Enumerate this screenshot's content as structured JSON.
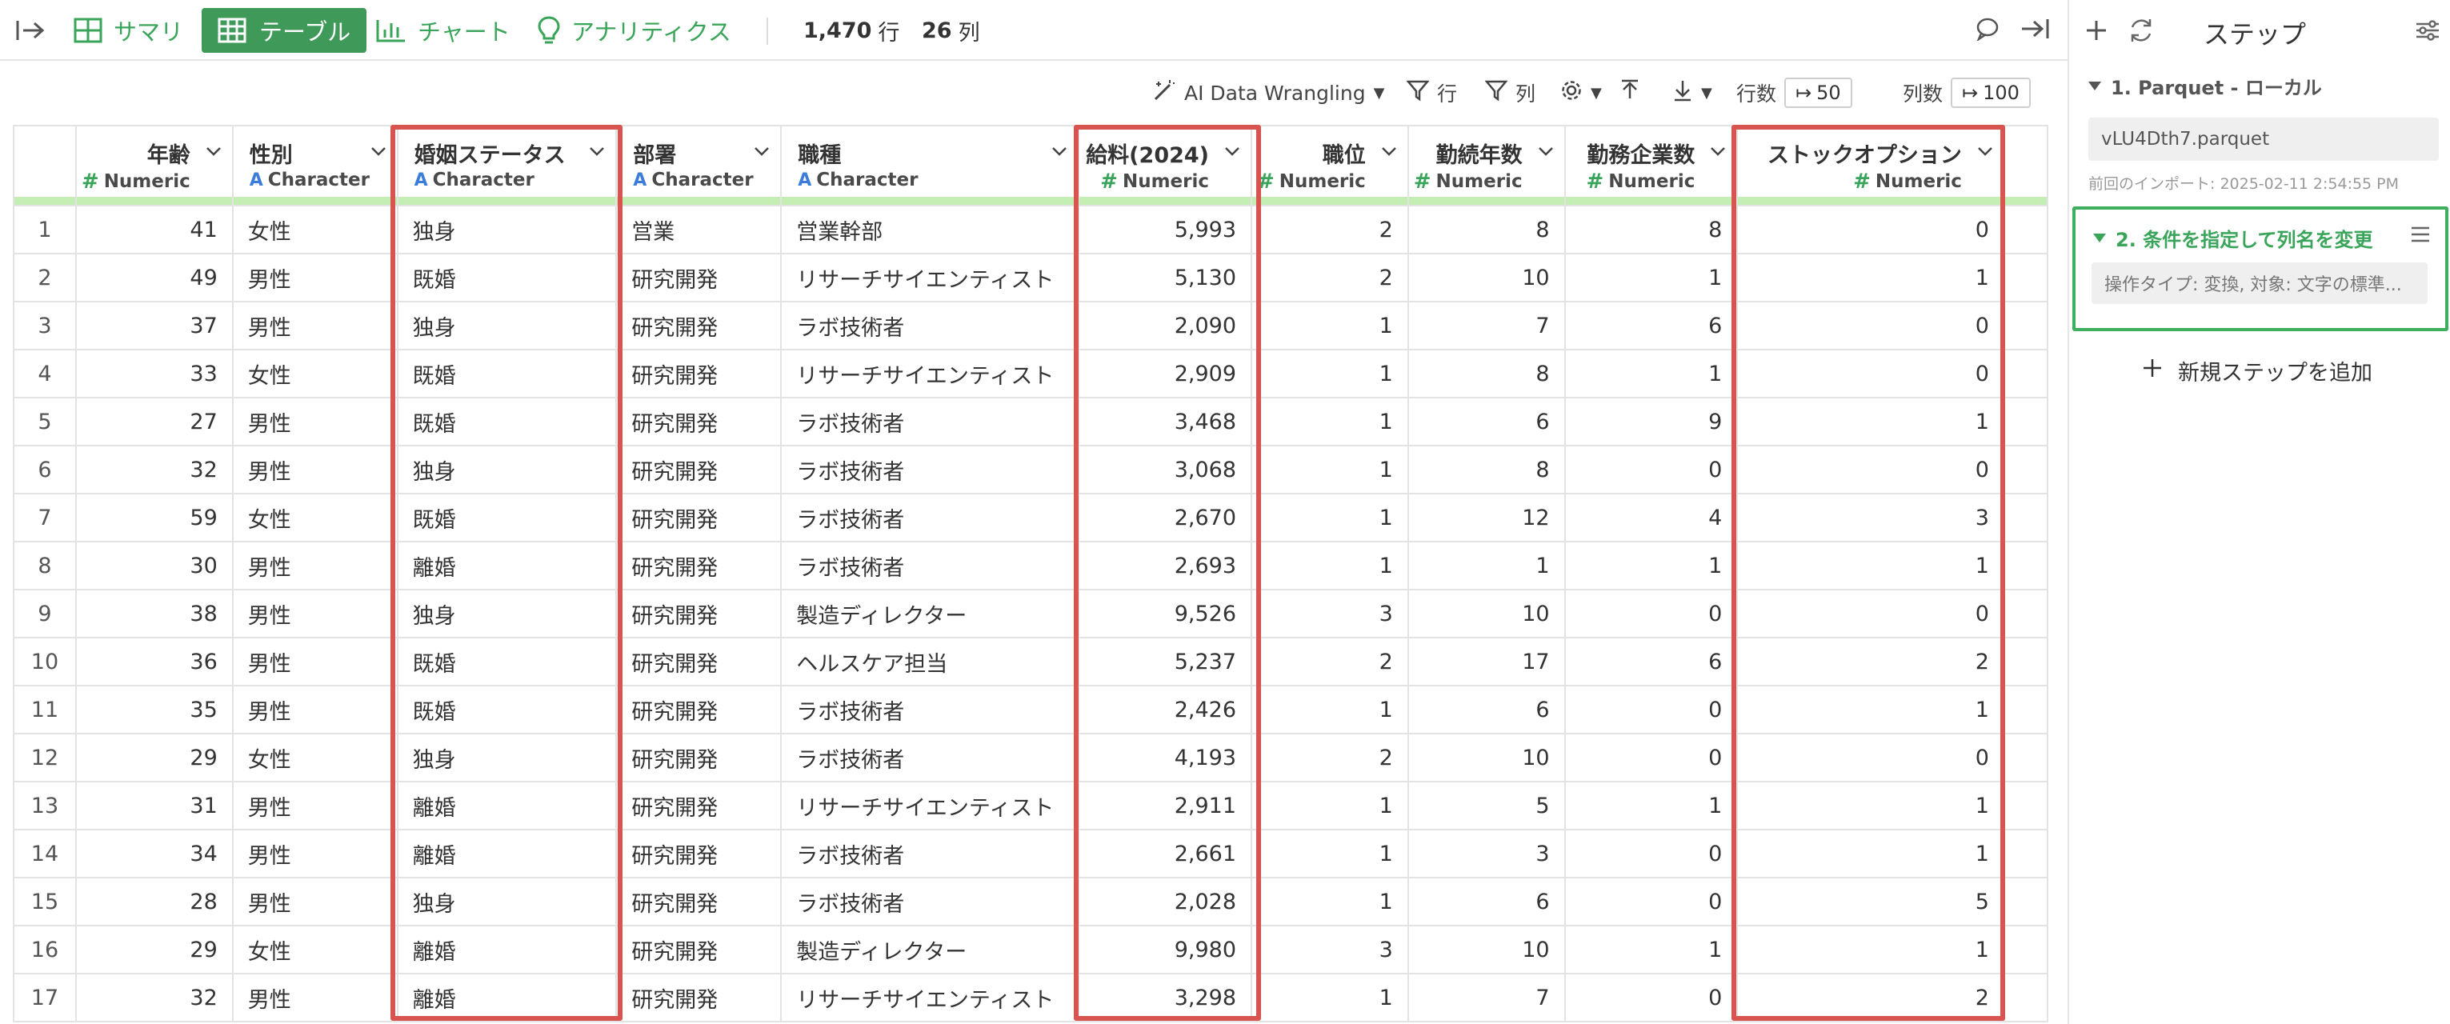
{
  "toolbar": {
    "summary": "サマリ",
    "table": "テーブル",
    "chart": "チャート",
    "analytics": "アナリティクス",
    "rows_count": "1,470",
    "rows_unit": "行",
    "cols_count": "26",
    "cols_unit": "列"
  },
  "subbar": {
    "ai": "AI Data Wrangling",
    "row_filter": "行",
    "col_filter": "列",
    "rows_label": "行数",
    "rows_value": "50",
    "cols_label": "列数",
    "cols_value": "100"
  },
  "columns": [
    {
      "name": "年齢",
      "type": "Numeric"
    },
    {
      "name": "性別",
      "type": "Character"
    },
    {
      "name": "婚姻ステータス",
      "type": "Character"
    },
    {
      "name": "部署",
      "type": "Character"
    },
    {
      "name": "職種",
      "type": "Character"
    },
    {
      "name": "給料(2024)",
      "type": "Numeric"
    },
    {
      "name": "職位",
      "type": "Numeric"
    },
    {
      "name": "勤続年数",
      "type": "Numeric"
    },
    {
      "name": "勤務企業数",
      "type": "Numeric"
    },
    {
      "name": "ストックオプション",
      "type": "Numeric"
    }
  ],
  "rows": [
    [
      "1",
      "41",
      "女性",
      "独身",
      "営業",
      "営業幹部",
      "5,993",
      "2",
      "8",
      "8",
      "0"
    ],
    [
      "2",
      "49",
      "男性",
      "既婚",
      "研究開発",
      "リサーチサイエンティスト",
      "5,130",
      "2",
      "10",
      "1",
      "1"
    ],
    [
      "3",
      "37",
      "男性",
      "独身",
      "研究開発",
      "ラボ技術者",
      "2,090",
      "1",
      "7",
      "6",
      "0"
    ],
    [
      "4",
      "33",
      "女性",
      "既婚",
      "研究開発",
      "リサーチサイエンティスト",
      "2,909",
      "1",
      "8",
      "1",
      "0"
    ],
    [
      "5",
      "27",
      "男性",
      "既婚",
      "研究開発",
      "ラボ技術者",
      "3,468",
      "1",
      "6",
      "9",
      "1"
    ],
    [
      "6",
      "32",
      "男性",
      "独身",
      "研究開発",
      "ラボ技術者",
      "3,068",
      "1",
      "8",
      "0",
      "0"
    ],
    [
      "7",
      "59",
      "女性",
      "既婚",
      "研究開発",
      "ラボ技術者",
      "2,670",
      "1",
      "12",
      "4",
      "3"
    ],
    [
      "8",
      "30",
      "男性",
      "離婚",
      "研究開発",
      "ラボ技術者",
      "2,693",
      "1",
      "1",
      "1",
      "1"
    ],
    [
      "9",
      "38",
      "男性",
      "独身",
      "研究開発",
      "製造ディレクター",
      "9,526",
      "3",
      "10",
      "0",
      "0"
    ],
    [
      "10",
      "36",
      "男性",
      "既婚",
      "研究開発",
      "ヘルスケア担当",
      "5,237",
      "2",
      "17",
      "6",
      "2"
    ],
    [
      "11",
      "35",
      "男性",
      "既婚",
      "研究開発",
      "ラボ技術者",
      "2,426",
      "1",
      "6",
      "0",
      "1"
    ],
    [
      "12",
      "29",
      "女性",
      "独身",
      "研究開発",
      "ラボ技術者",
      "4,193",
      "2",
      "10",
      "0",
      "0"
    ],
    [
      "13",
      "31",
      "男性",
      "離婚",
      "研究開発",
      "リサーチサイエンティスト",
      "2,911",
      "1",
      "5",
      "1",
      "1"
    ],
    [
      "14",
      "34",
      "男性",
      "離婚",
      "研究開発",
      "ラボ技術者",
      "2,661",
      "1",
      "3",
      "0",
      "1"
    ],
    [
      "15",
      "28",
      "男性",
      "独身",
      "研究開発",
      "ラボ技術者",
      "2,028",
      "1",
      "6",
      "0",
      "5"
    ],
    [
      "16",
      "29",
      "女性",
      "離婚",
      "研究開発",
      "製造ディレクター",
      "9,980",
      "3",
      "10",
      "1",
      "1"
    ],
    [
      "17",
      "32",
      "男性",
      "離婚",
      "研究開発",
      "リサーチサイエンティスト",
      "3,298",
      "1",
      "7",
      "0",
      "2"
    ]
  ],
  "panel": {
    "title": "ステップ",
    "step1_title": "1. Parquet - ローカル",
    "step1_file": "vLU4Dth7.parquet",
    "step1_time": "前回のインポート: 2025-02-11 2:54:55 PM",
    "step2_title": "2. 条件を指定して列名を変更",
    "step2_desc": "操作タイプ: 変換, 対象: 文字の標準...",
    "add_step": "新規ステップを追加"
  }
}
